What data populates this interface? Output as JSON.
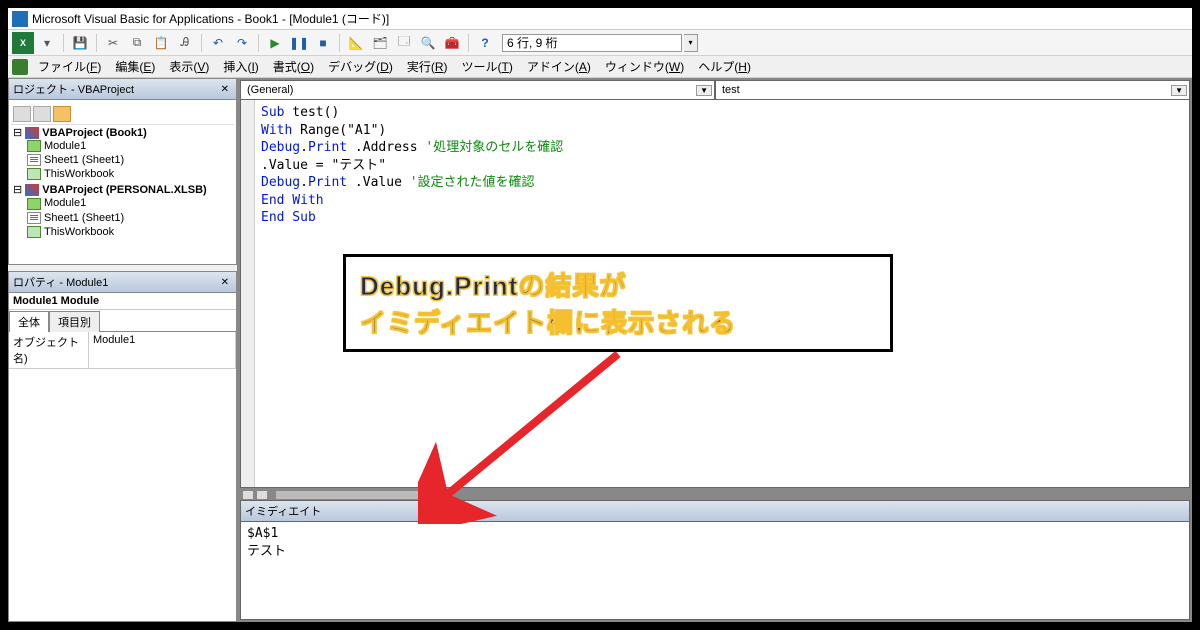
{
  "window": {
    "title": "Microsoft Visual Basic for Applications - Book1 - [Module1 (コード)]"
  },
  "menu": {
    "file": "ファイル",
    "file_u": "F",
    "edit": "編集",
    "edit_u": "E",
    "view": "表示",
    "view_u": "V",
    "insert": "挿入",
    "insert_u": "I",
    "format": "書式",
    "format_u": "O",
    "debug": "デバッグ",
    "debug_u": "D",
    "run": "実行",
    "run_u": "R",
    "tools": "ツール",
    "tools_u": "T",
    "addins": "アドイン",
    "addins_u": "A",
    "window": "ウィンドウ",
    "window_u": "W",
    "help": "ヘルプ",
    "help_u": "H"
  },
  "toolbar": {
    "status": "6 行, 9 桁"
  },
  "project_panel": {
    "title": "ロジェクト - VBAProject"
  },
  "tree": {
    "p1": "VBAProject (Book1)",
    "p1_mod": "Module1",
    "p1_sheet": "Sheet1 (Sheet1)",
    "p1_wb": "ThisWorkbook",
    "p2": "VBAProject (PERSONAL.XLSB)",
    "p2_mod": "Module1",
    "p2_sheet": "Sheet1 (Sheet1)",
    "p2_wb": "ThisWorkbook"
  },
  "props": {
    "panel_title": "ロパティ - Module1",
    "obj_line": "Module1 Module",
    "tab_all": "全体",
    "tab_cat": "項目別",
    "row_label": "オブジェクト名)",
    "row_value": "Module1"
  },
  "code_dd": {
    "left": "(General)",
    "right": "test"
  },
  "code": {
    "l1a": "Sub",
    "l1b": " test()",
    "l2a": "With",
    "l2b": " Range(\"A1\")",
    "l3a": "Debug",
    "l3b": ".",
    "l3c": "Print",
    "l3d": " .Address ",
    "l3e": "'処理対象のセルを確認",
    "l4": ".Value = \"テスト\"",
    "l5a": "Debug",
    "l5b": ".",
    "l5c": "Print",
    "l5d": " .Value ",
    "l5e": "'設定された値を確認",
    "l6": "End With",
    "l7": "End Sub"
  },
  "immediate": {
    "title": "イミディエイト",
    "out1": "$A$1",
    "out2": "テスト"
  },
  "callout": {
    "line1": "Debug.Printの結果が",
    "line2": "イミディエイト欄に表示される"
  }
}
